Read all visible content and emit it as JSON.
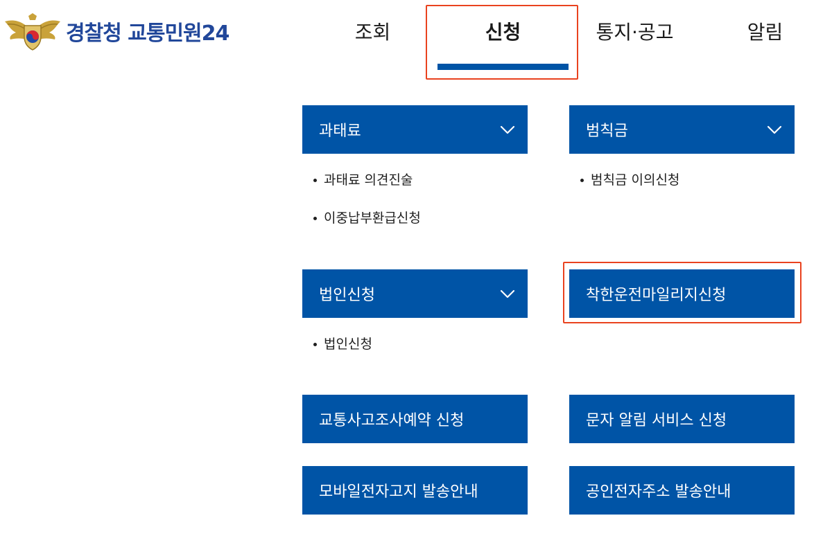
{
  "colors": {
    "brand_blue": "#0054A6",
    "logo_text_blue": "#21479A",
    "highlight_orange": "#E9421E",
    "logo_gold": "#C9A23A"
  },
  "header": {
    "logo": {
      "emblem_icon": "police-emblem-icon",
      "text": "경찰청 교통민원24"
    },
    "nav": [
      {
        "label": "조회"
      },
      {
        "label": "신청",
        "active": true
      },
      {
        "label": "통지·공고"
      },
      {
        "label": "알림"
      }
    ]
  },
  "menu": {
    "fine": {
      "title": "과태료",
      "icon": "chevron-down-icon",
      "items": [
        "과태료 의견진술",
        "이중납부환급신청"
      ]
    },
    "penalty": {
      "title": "범칙금",
      "icon": "chevron-down-icon",
      "items": [
        "범칙금 이의신청"
      ]
    },
    "corporate": {
      "title": "법인신청",
      "icon": "chevron-down-icon",
      "items": [
        "법인신청"
      ]
    },
    "mileage": {
      "title": "착한운전마일리지신청"
    },
    "services": [
      "교통사고조사예약 신청",
      "문자 알림 서비스 신청",
      "모바일전자고지 발송안내",
      "공인전자주소 발송안내"
    ]
  }
}
